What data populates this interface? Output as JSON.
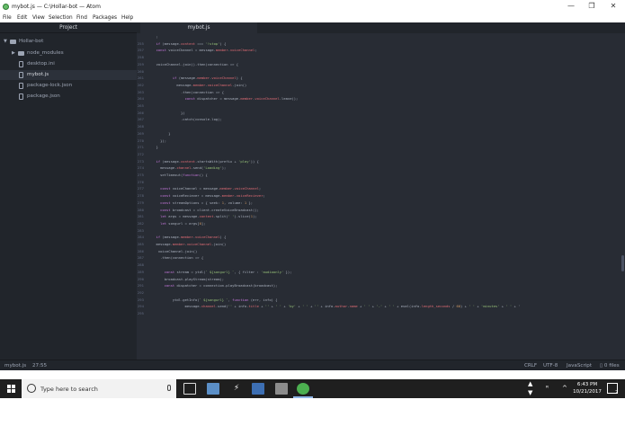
{
  "window": {
    "title": "mybot.js — C:\\Hollar-bot — Atom",
    "minimize": "—",
    "maximize": "❐",
    "close": "✕"
  },
  "menu": [
    "File",
    "Edit",
    "View",
    "Selection",
    "Find",
    "Packages",
    "Help"
  ],
  "panel": {
    "project_tab": "Project",
    "file_tab": "mybot.js"
  },
  "tree": [
    {
      "label": "Hollar-bot",
      "type": "root"
    },
    {
      "label": "node_modules",
      "type": "folder"
    },
    {
      "label": "desktop.ini",
      "type": "file"
    },
    {
      "label": "mybot.js",
      "type": "file",
      "selected": true
    },
    {
      "label": "package-lock.json",
      "type": "file"
    },
    {
      "label": "package.json",
      "type": "file"
    }
  ],
  "editor": {
    "lines": [
      {
        "n": "",
        "code": "  ;"
      },
      {
        "n": "255",
        "code": "  if (message.content === '!stop') {"
      },
      {
        "n": "257",
        "code": "  const voiceChannel = message.member.voiceChannel;"
      },
      {
        "n": "258",
        "code": ""
      },
      {
        "n": "259",
        "code": "  voiceChannel.join().then(connection => {"
      },
      {
        "n": "260",
        "code": ""
      },
      {
        "n": "261",
        "code": "          if (message.member.voiceChannel) {"
      },
      {
        "n": "262",
        "code": "            message.member.voiceChannel.join()"
      },
      {
        "n": "263",
        "code": "              .then(connection => {"
      },
      {
        "n": "264",
        "code": "                const dispatcher = message.member.voiceChannel.leave();"
      },
      {
        "n": "265",
        "code": ""
      },
      {
        "n": "266",
        "code": "              })"
      },
      {
        "n": "267",
        "code": "              .catch(console.log);"
      },
      {
        "n": "268",
        "code": ""
      },
      {
        "n": "269",
        "code": "        }"
      },
      {
        "n": "270",
        "code": "    });"
      },
      {
        "n": "271",
        "code": "  }"
      },
      {
        "n": "272",
        "code": ""
      },
      {
        "n": "273",
        "code": "  if (message.content.startsWith(prefix + 'play')) {"
      },
      {
        "n": "274",
        "code": "    message.channel.send('Loading');"
      },
      {
        "n": "275",
        "code": "    setTimeout(function() {"
      },
      {
        "n": "276",
        "code": ""
      },
      {
        "n": "277",
        "code": "    const voiceChannel = message.member.voiceChannel;"
      },
      {
        "n": "278",
        "code": "    const voiceReciever = message.member.voiceReciever;"
      },
      {
        "n": "279",
        "code": "    const streamOptions = { seek: 1, volume: 1 };"
      },
      {
        "n": "280",
        "code": "    const broadcast = client.createVoiceBroadcast();"
      },
      {
        "n": "281",
        "code": "    let args = message.content.split(' ').slice(1);"
      },
      {
        "n": "282",
        "code": "    let songurl = args[0];"
      },
      {
        "n": "283",
        "code": ""
      },
      {
        "n": "284",
        "code": "  if (message.member.voiceChannel) {"
      },
      {
        "n": "285",
        "code": "  message.member.voiceChannel.join()"
      },
      {
        "n": "286",
        "code": "   voiceChannel.join()"
      },
      {
        "n": "287",
        "code": "    .then(connection => {"
      },
      {
        "n": "288",
        "code": ""
      },
      {
        "n": "289",
        "code": "      const stream = ytdl(` ${songurl} `, { filter : 'audioonly' });"
      },
      {
        "n": "290",
        "code": "      broadcast.playStream(stream);"
      },
      {
        "n": "291",
        "code": "      const dispatcher = connection.playBroadcast(broadcast);"
      },
      {
        "n": "292",
        "code": ""
      },
      {
        "n": "293",
        "code": "          ytdl.getInfo(` ${songurl} `, function (err, info) {"
      },
      {
        "n": "294",
        "code": "                message.channel.send('' + info.title + '' + ' ' + 'by' + ' ' + '' + info.author.name + ' ' + '-' + ' ' + eval(info.length_seconds / 60) + ' ' + 'minutes' + ' ' + '"
      },
      {
        "n": "295",
        "code": ""
      }
    ]
  },
  "status": {
    "file": "mybot.js",
    "cursor": "27:55",
    "line_ending": "CRLF",
    "encoding": "UTF-8",
    "grammar": "JavaScript",
    "files": "0 files"
  },
  "taskbar": {
    "search_placeholder": "Type here to search",
    "time": "6:43 PM",
    "date": "10/21/2017",
    "notifications": "2"
  },
  "colors": {
    "editor_bg": "#282c34",
    "panel_bg": "#21252b",
    "keyword": "#c678dd",
    "string": "#98c379",
    "property": "#e06c75"
  }
}
